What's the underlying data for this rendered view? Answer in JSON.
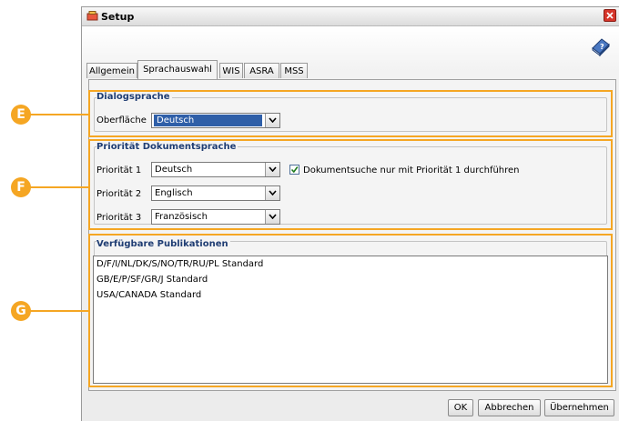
{
  "window": {
    "title": "Setup"
  },
  "tabs": [
    {
      "label": "Allgemein",
      "active": false
    },
    {
      "label": "Sprachauswahl",
      "active": true
    },
    {
      "label": "WIS",
      "active": false
    },
    {
      "label": "ASRA",
      "active": false
    },
    {
      "label": "MSS",
      "active": false
    }
  ],
  "dialogsprache": {
    "title": "Dialogsprache",
    "oberflaeche_label": "Oberfläche",
    "oberflaeche_value": "Deutsch"
  },
  "prioritaet": {
    "title": "Priorität Dokumentsprache",
    "rows": [
      {
        "label": "Priorität 1",
        "value": "Deutsch"
      },
      {
        "label": "Priorität 2",
        "value": "Englisch"
      },
      {
        "label": "Priorität 3",
        "value": "Französisch"
      }
    ],
    "checkbox_label": "Dokumentsuche nur mit Priorität 1 durchführen",
    "checkbox_checked": true
  },
  "publikationen": {
    "title": "Verfügbare Publikationen",
    "items": [
      "D/F/I/NL/DK/S/NO/TR/RU/PL Standard",
      "GB/E/P/SF/GR/J Standard",
      "USA/CANADA Standard"
    ]
  },
  "buttons": {
    "ok": "OK",
    "cancel": "Abbrechen",
    "apply": "Übernehmen"
  },
  "callouts": [
    "E",
    "F",
    "G"
  ],
  "colors": {
    "accent": "#f5a623",
    "group_title": "#1f3d73",
    "selection": "#2f5fa8",
    "close": "#d6352a"
  }
}
